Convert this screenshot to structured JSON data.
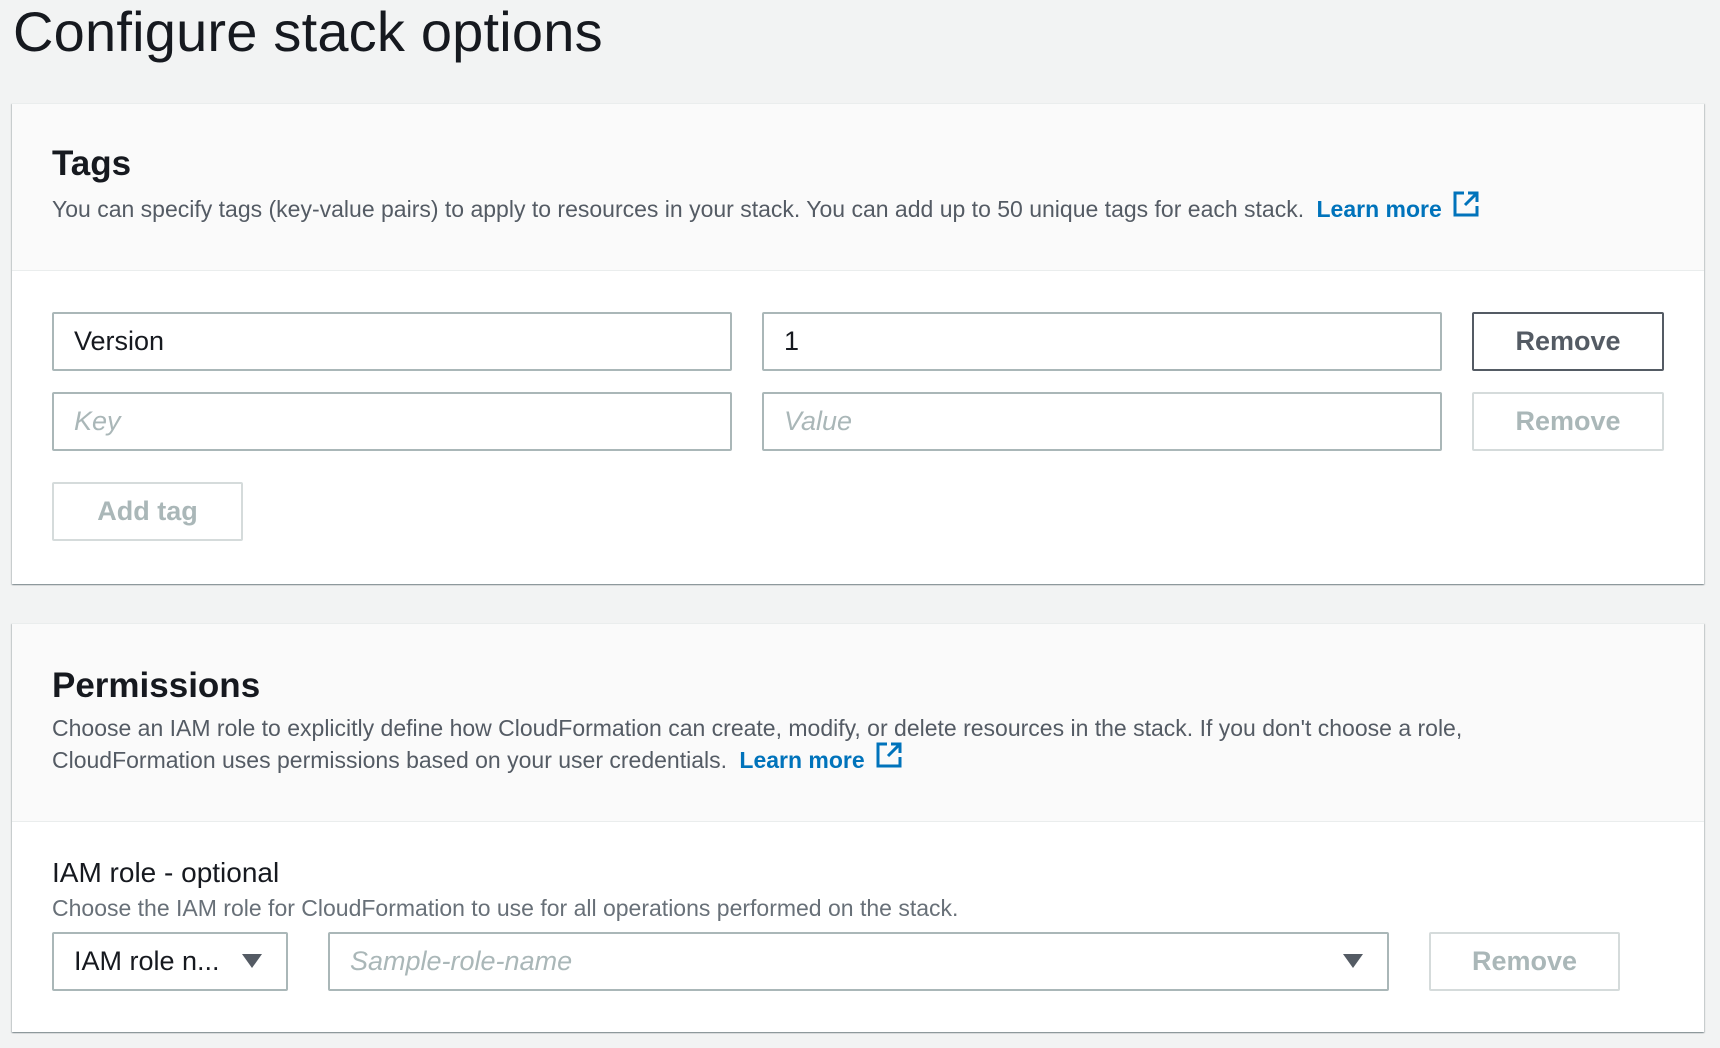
{
  "page": {
    "title": "Configure stack options"
  },
  "tags": {
    "title": "Tags",
    "description": "You can specify tags (key-value pairs) to apply to resources in your stack. You can add up to 50 unique tags for each stack.",
    "learn_more": "Learn more",
    "rows": [
      {
        "key": "Version",
        "value": "1",
        "key_placeholder": "Key",
        "value_placeholder": "Value",
        "remove_label": "Remove"
      },
      {
        "key": "",
        "value": "",
        "key_placeholder": "Key",
        "value_placeholder": "Value",
        "remove_label": "Remove"
      }
    ],
    "add_tag_label": "Add tag"
  },
  "permissions": {
    "title": "Permissions",
    "description_line1": "Choose an IAM role to explicitly define how CloudFormation can create, modify, or delete resources in the stack. If you don't choose a role,",
    "description_line2": "CloudFormation uses permissions based on your user credentials.",
    "learn_more": "Learn more",
    "iam_role": {
      "label": "IAM role - optional",
      "description": "Choose the IAM role for CloudFormation to use for all operations performed on the stack.",
      "type_select": "IAM role n...",
      "role_placeholder": "Sample-role-name",
      "remove_label": "Remove"
    }
  },
  "colors": {
    "link": "#0073bb",
    "background": "#f2f3f3",
    "border": "#aab7b8"
  },
  "icons": {
    "external_link": "external-link-icon",
    "dropdown": "caret-down-icon"
  }
}
